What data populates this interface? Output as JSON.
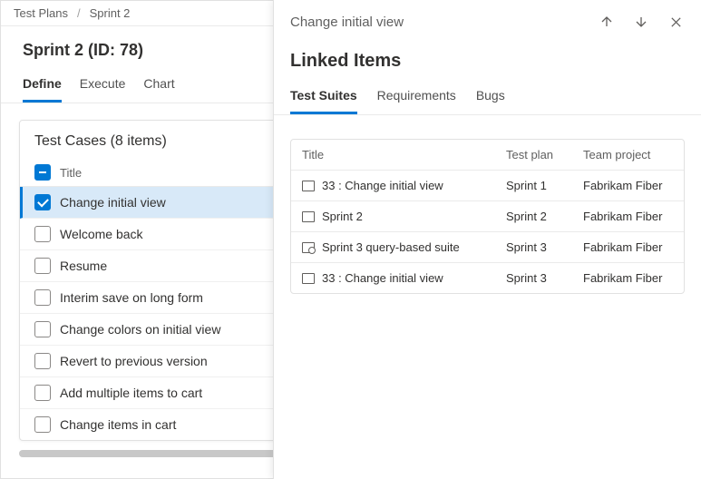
{
  "breadcrumb": {
    "root": "Test Plans",
    "current": "Sprint 2"
  },
  "page_title": "Sprint 2 (ID: 78)",
  "tabs": [
    {
      "label": "Define",
      "active": true
    },
    {
      "label": "Execute",
      "active": false
    },
    {
      "label": "Chart",
      "active": false
    }
  ],
  "test_cases": {
    "heading": "Test Cases (8 items)",
    "column_title": "Title",
    "items": [
      {
        "title": "Change initial view",
        "selected": true,
        "checked": true
      },
      {
        "title": "Welcome back",
        "selected": false,
        "checked": false
      },
      {
        "title": "Resume",
        "selected": false,
        "checked": false
      },
      {
        "title": "Interim save on long form",
        "selected": false,
        "checked": false
      },
      {
        "title": "Change colors on initial view",
        "selected": false,
        "checked": false
      },
      {
        "title": "Revert to previous version",
        "selected": false,
        "checked": false
      },
      {
        "title": "Add multiple items to cart",
        "selected": false,
        "checked": false
      },
      {
        "title": "Change items in cart",
        "selected": false,
        "checked": false
      }
    ]
  },
  "panel": {
    "title": "Change initial view",
    "section_title": "Linked Items",
    "tabs": [
      {
        "label": "Test Suites",
        "active": true
      },
      {
        "label": "Requirements",
        "active": false
      },
      {
        "label": "Bugs",
        "active": false
      }
    ],
    "columns": {
      "title": "Title",
      "plan": "Test plan",
      "team": "Team project"
    },
    "rows": [
      {
        "title": "33 : Change initial view",
        "plan": "Sprint 1",
        "team": "Fabrikam Fiber",
        "icon": "suite"
      },
      {
        "title": "Sprint 2",
        "plan": "Sprint 2",
        "team": "Fabrikam Fiber",
        "icon": "suite"
      },
      {
        "title": "Sprint 3 query-based suite",
        "plan": "Sprint 3",
        "team": "Fabrikam Fiber",
        "icon": "query"
      },
      {
        "title": "33 : Change initial view",
        "plan": "Sprint 3",
        "team": "Fabrikam Fiber",
        "icon": "suite"
      }
    ]
  }
}
